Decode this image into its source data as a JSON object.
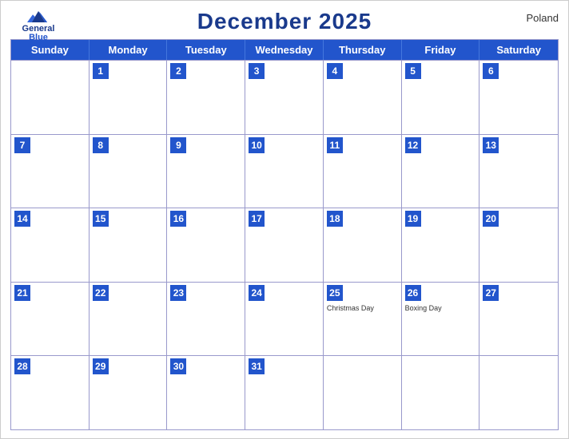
{
  "header": {
    "title": "December 2025",
    "country": "Poland",
    "logo_general": "General",
    "logo_blue": "Blue"
  },
  "dayHeaders": [
    "Sunday",
    "Monday",
    "Tuesday",
    "Wednesday",
    "Thursday",
    "Friday",
    "Saturday"
  ],
  "weeks": [
    [
      {
        "date": "",
        "holiday": ""
      },
      {
        "date": "1",
        "holiday": ""
      },
      {
        "date": "2",
        "holiday": ""
      },
      {
        "date": "3",
        "holiday": ""
      },
      {
        "date": "4",
        "holiday": ""
      },
      {
        "date": "5",
        "holiday": ""
      },
      {
        "date": "6",
        "holiday": ""
      }
    ],
    [
      {
        "date": "7",
        "holiday": ""
      },
      {
        "date": "8",
        "holiday": ""
      },
      {
        "date": "9",
        "holiday": ""
      },
      {
        "date": "10",
        "holiday": ""
      },
      {
        "date": "11",
        "holiday": ""
      },
      {
        "date": "12",
        "holiday": ""
      },
      {
        "date": "13",
        "holiday": ""
      }
    ],
    [
      {
        "date": "14",
        "holiday": ""
      },
      {
        "date": "15",
        "holiday": ""
      },
      {
        "date": "16",
        "holiday": ""
      },
      {
        "date": "17",
        "holiday": ""
      },
      {
        "date": "18",
        "holiday": ""
      },
      {
        "date": "19",
        "holiday": ""
      },
      {
        "date": "20",
        "holiday": ""
      }
    ],
    [
      {
        "date": "21",
        "holiday": ""
      },
      {
        "date": "22",
        "holiday": ""
      },
      {
        "date": "23",
        "holiday": ""
      },
      {
        "date": "24",
        "holiday": ""
      },
      {
        "date": "25",
        "holiday": "Christmas Day"
      },
      {
        "date": "26",
        "holiday": "Boxing Day"
      },
      {
        "date": "27",
        "holiday": ""
      }
    ],
    [
      {
        "date": "28",
        "holiday": ""
      },
      {
        "date": "29",
        "holiday": ""
      },
      {
        "date": "30",
        "holiday": ""
      },
      {
        "date": "31",
        "holiday": ""
      },
      {
        "date": "",
        "holiday": ""
      },
      {
        "date": "",
        "holiday": ""
      },
      {
        "date": "",
        "holiday": ""
      }
    ]
  ]
}
